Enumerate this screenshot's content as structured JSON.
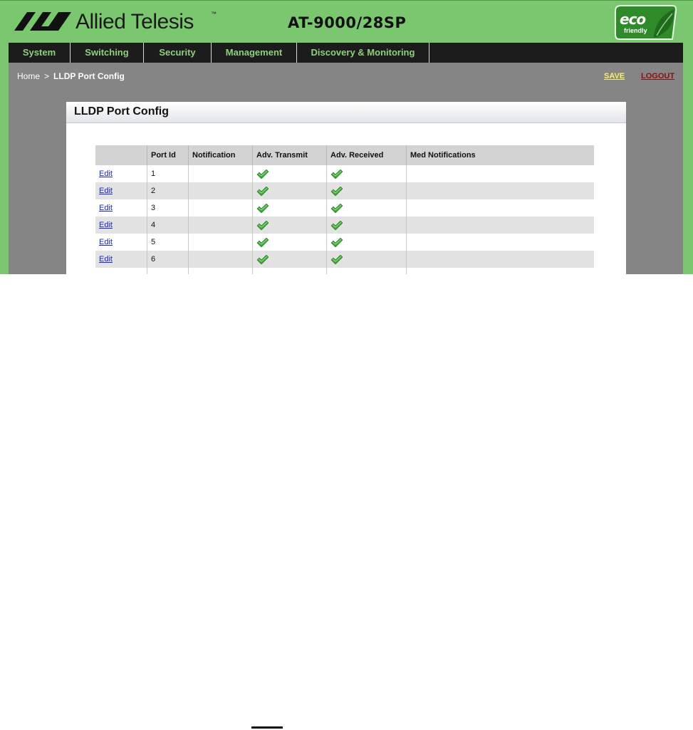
{
  "header": {
    "brand": "Allied Telesis",
    "trademark": "™",
    "model": "AT-9000/28SP",
    "eco_badge": {
      "main": "eco",
      "sub": "friendly",
      "icon": "leaf-icon"
    }
  },
  "nav": {
    "items": [
      {
        "label": "System"
      },
      {
        "label": "Switching"
      },
      {
        "label": "Security"
      },
      {
        "label": "Management"
      },
      {
        "label": "Discovery & Monitoring"
      }
    ]
  },
  "breadcrumb": {
    "home": "Home",
    "separator": ">",
    "current": "LLDP Port Config"
  },
  "actions": {
    "save": "SAVE",
    "logout": "LOGOUT"
  },
  "panel": {
    "title": "LLDP Port Config"
  },
  "table": {
    "columns": [
      "",
      "Port Id",
      "Notification",
      "Adv. Transmit",
      "Adv. Received",
      "Med Notifications"
    ],
    "rows": [
      {
        "action": "Edit",
        "port_id": "1",
        "notification": "",
        "adv_transmit": true,
        "adv_received": true,
        "med_notifications": ""
      },
      {
        "action": "Edit",
        "port_id": "2",
        "notification": "",
        "adv_transmit": true,
        "adv_received": true,
        "med_notifications": ""
      },
      {
        "action": "Edit",
        "port_id": "3",
        "notification": "",
        "adv_transmit": true,
        "adv_received": true,
        "med_notifications": ""
      },
      {
        "action": "Edit",
        "port_id": "4",
        "notification": "",
        "adv_transmit": true,
        "adv_received": true,
        "med_notifications": ""
      },
      {
        "action": "Edit",
        "port_id": "5",
        "notification": "",
        "adv_transmit": true,
        "adv_received": true,
        "med_notifications": ""
      },
      {
        "action": "Edit",
        "port_id": "6",
        "notification": "",
        "adv_transmit": true,
        "adv_received": true,
        "med_notifications": ""
      }
    ]
  },
  "colors": {
    "header_green": "#7bc770",
    "nav_bg": "#1c1c1c",
    "nav_text": "#8ed07f",
    "content_gray": "#858585",
    "save": "#f6f06a",
    "logout": "#8a1010",
    "check_green": "#3fa33a"
  }
}
